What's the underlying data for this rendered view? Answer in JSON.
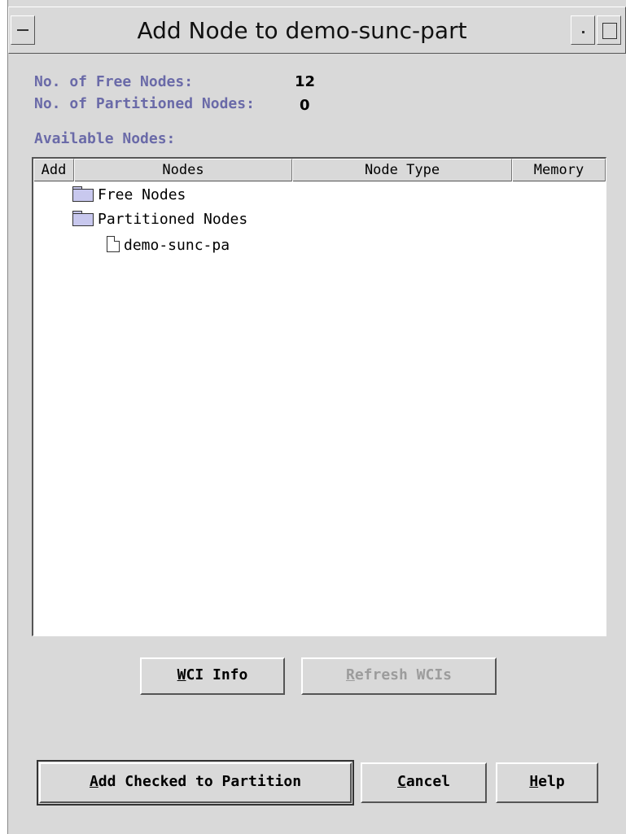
{
  "window": {
    "title": "Add Node to demo-sunc-part"
  },
  "summary": {
    "free_nodes_label": "No. of Free Nodes:",
    "free_nodes_value": "12",
    "partitioned_nodes_label": "No. of Partitioned Nodes:",
    "partitioned_nodes_value": "0",
    "available_nodes_label": "Available Nodes:"
  },
  "table": {
    "columns": [
      "Add",
      "Nodes",
      "Node Type",
      "Memory"
    ],
    "rows": [
      {
        "label": "Free Nodes",
        "icon": "folder-icon"
      },
      {
        "label": "Partitioned Nodes",
        "icon": "folder-icon"
      },
      {
        "label": "demo-sunc-pa",
        "icon": "file-icon"
      }
    ]
  },
  "buttons": {
    "wci_info_mnemonic": "W",
    "wci_info_rest": "CI Info",
    "refresh_wcis_mnemonic": "R",
    "refresh_wcis_rest": "efresh WCIs",
    "add_checked_mnemonic": "A",
    "add_checked_rest": "dd Checked to Partition",
    "cancel_mnemonic": "C",
    "cancel_rest": "ancel",
    "help_mnemonic": "H",
    "help_rest": "elp"
  },
  "colors": {
    "label": "#6a6aa8",
    "background": "#d9d9d9",
    "disabled_text": "#9c9c9c",
    "folder_fill": "#c8c8ee"
  }
}
